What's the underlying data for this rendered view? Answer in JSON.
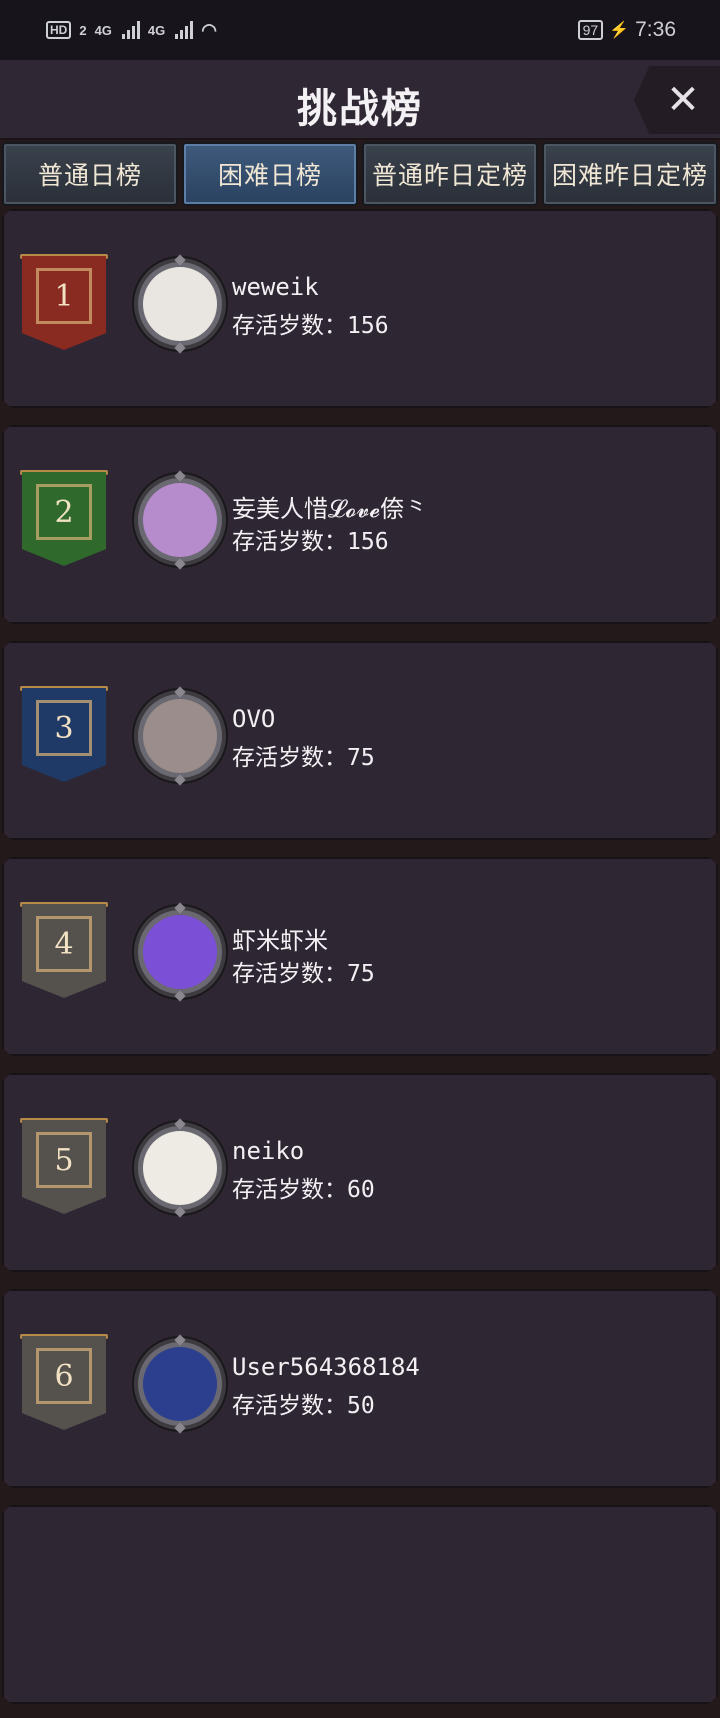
{
  "status_bar": {
    "hd_label": "HD",
    "hd_sub": "2",
    "network_1": "4G",
    "network_2": "4G",
    "battery": "97",
    "time": "7:36"
  },
  "header": {
    "title": "挑战榜",
    "close_label": "✕"
  },
  "tabs": [
    {
      "label": "普通日榜",
      "active": false
    },
    {
      "label": "困难日榜",
      "active": true
    },
    {
      "label": "普通昨日定榜",
      "active": false
    },
    {
      "label": "困难昨日定榜",
      "active": false
    }
  ],
  "age_prefix": "存活岁数：",
  "entries": [
    {
      "rank": "1",
      "name": "weweik",
      "age": "156",
      "banner_color": "#8a2b22",
      "avatar_color": "#e9e6e2",
      "avatar_glyph": ""
    },
    {
      "rank": "2",
      "name": "妄美人惜𝓛𝓸𝓿𝓮倷⺀",
      "age": "156",
      "banner_color": "#2f6a2c",
      "avatar_color": "#b78ccc",
      "avatar_glyph": ""
    },
    {
      "rank": "3",
      "name": "OVO",
      "age": "75",
      "banner_color": "#1f3a66",
      "avatar_color": "#9a8d8b",
      "avatar_glyph": ""
    },
    {
      "rank": "4",
      "name": "虾米虾米",
      "age": "75",
      "banner_color": "#55524e",
      "avatar_color": "#7b4fd6",
      "avatar_glyph": ""
    },
    {
      "rank": "5",
      "name": "neiko",
      "age": "60",
      "banner_color": "#55524e",
      "avatar_color": "#eeeae4",
      "avatar_glyph": ""
    },
    {
      "rank": "6",
      "name": "User564368184",
      "age": "50",
      "banner_color": "#55524e",
      "avatar_color": "#2c3f8e",
      "avatar_glyph": ""
    }
  ]
}
